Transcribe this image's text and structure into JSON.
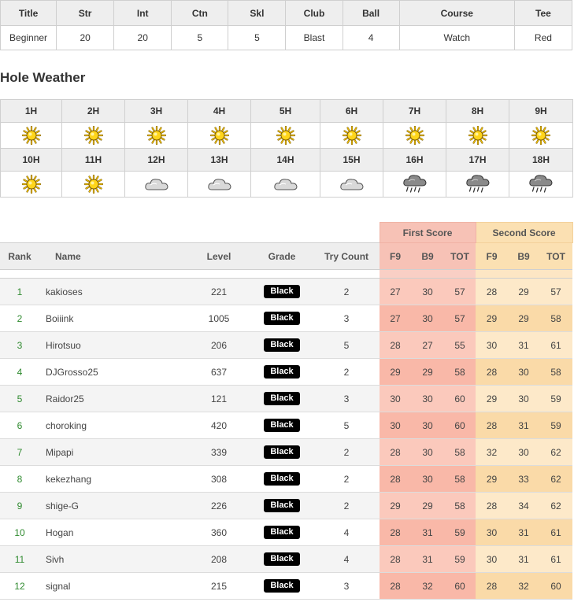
{
  "stats": {
    "headers": [
      "Title",
      "Str",
      "Int",
      "Ctn",
      "Skl",
      "Club",
      "Ball",
      "Course",
      "Tee"
    ],
    "values": [
      "Beginner",
      "20",
      "20",
      "5",
      "5",
      "Blast",
      "4",
      "Watch",
      "Red"
    ]
  },
  "weather": {
    "heading": "Hole Weather",
    "row1_holes": [
      "1H",
      "2H",
      "3H",
      "4H",
      "5H",
      "6H",
      "7H",
      "8H",
      "9H"
    ],
    "row1_icons": [
      "sun-icon",
      "sun-icon",
      "sun-icon",
      "sun-icon",
      "sun-icon",
      "sun-icon",
      "sun-icon",
      "sun-icon",
      "sun-icon"
    ],
    "row2_holes": [
      "10H",
      "11H",
      "12H",
      "13H",
      "14H",
      "15H",
      "16H",
      "17H",
      "18H"
    ],
    "row2_icons": [
      "sun-icon",
      "sun-icon",
      "cloud-icon",
      "cloud-icon",
      "cloud-icon",
      "cloud-icon",
      "rain-icon",
      "rain-icon",
      "rain-icon"
    ]
  },
  "ranking": {
    "group_first": "First Score",
    "group_second": "Second Score",
    "headers": {
      "rank": "Rank",
      "name": "Name",
      "level": "Level",
      "grade": "Grade",
      "try_count": "Try Count",
      "f9": "F9",
      "b9": "B9",
      "tot": "TOT"
    },
    "rows": [
      {
        "rank": "1",
        "name": "kakioses",
        "level": "221",
        "grade": "Black",
        "try": "2",
        "f1": "27",
        "b1": "30",
        "t1": "57",
        "f2": "28",
        "b2": "29",
        "t2": "57"
      },
      {
        "rank": "2",
        "name": "Boiiink",
        "level": "1005",
        "grade": "Black",
        "try": "3",
        "f1": "27",
        "b1": "30",
        "t1": "57",
        "f2": "29",
        "b2": "29",
        "t2": "58"
      },
      {
        "rank": "3",
        "name": "Hirotsuo",
        "level": "206",
        "grade": "Black",
        "try": "5",
        "f1": "28",
        "b1": "27",
        "t1": "55",
        "f2": "30",
        "b2": "31",
        "t2": "61"
      },
      {
        "rank": "4",
        "name": "DJGrosso25",
        "level": "637",
        "grade": "Black",
        "try": "2",
        "f1": "29",
        "b1": "29",
        "t1": "58",
        "f2": "28",
        "b2": "30",
        "t2": "58"
      },
      {
        "rank": "5",
        "name": "Raidor25",
        "level": "121",
        "grade": "Black",
        "try": "3",
        "f1": "30",
        "b1": "30",
        "t1": "60",
        "f2": "29",
        "b2": "30",
        "t2": "59"
      },
      {
        "rank": "6",
        "name": "choroking",
        "level": "420",
        "grade": "Black",
        "try": "5",
        "f1": "30",
        "b1": "30",
        "t1": "60",
        "f2": "28",
        "b2": "31",
        "t2": "59"
      },
      {
        "rank": "7",
        "name": "Mipapi",
        "level": "339",
        "grade": "Black",
        "try": "2",
        "f1": "28",
        "b1": "30",
        "t1": "58",
        "f2": "32",
        "b2": "30",
        "t2": "62"
      },
      {
        "rank": "8",
        "name": "kekezhang",
        "level": "308",
        "grade": "Black",
        "try": "2",
        "f1": "28",
        "b1": "30",
        "t1": "58",
        "f2": "29",
        "b2": "33",
        "t2": "62"
      },
      {
        "rank": "9",
        "name": "shige-G",
        "level": "226",
        "grade": "Black",
        "try": "2",
        "f1": "29",
        "b1": "29",
        "t1": "58",
        "f2": "28",
        "b2": "34",
        "t2": "62"
      },
      {
        "rank": "10",
        "name": "Hogan",
        "level": "360",
        "grade": "Black",
        "try": "4",
        "f1": "28",
        "b1": "31",
        "t1": "59",
        "f2": "30",
        "b2": "31",
        "t2": "61"
      },
      {
        "rank": "11",
        "name": "Sivh",
        "level": "208",
        "grade": "Black",
        "try": "4",
        "f1": "28",
        "b1": "31",
        "t1": "59",
        "f2": "30",
        "b2": "31",
        "t2": "61"
      },
      {
        "rank": "12",
        "name": "signal",
        "level": "215",
        "grade": "Black",
        "try": "3",
        "f1": "28",
        "b1": "32",
        "t1": "60",
        "f2": "28",
        "b2": "32",
        "t2": "60"
      }
    ]
  },
  "colors": {
    "first_score_bg": "#f7c2b6",
    "second_score_bg": "#fbe0b2",
    "rank_text": "#2f8a2f",
    "grade_badge_bg": "#000000"
  }
}
